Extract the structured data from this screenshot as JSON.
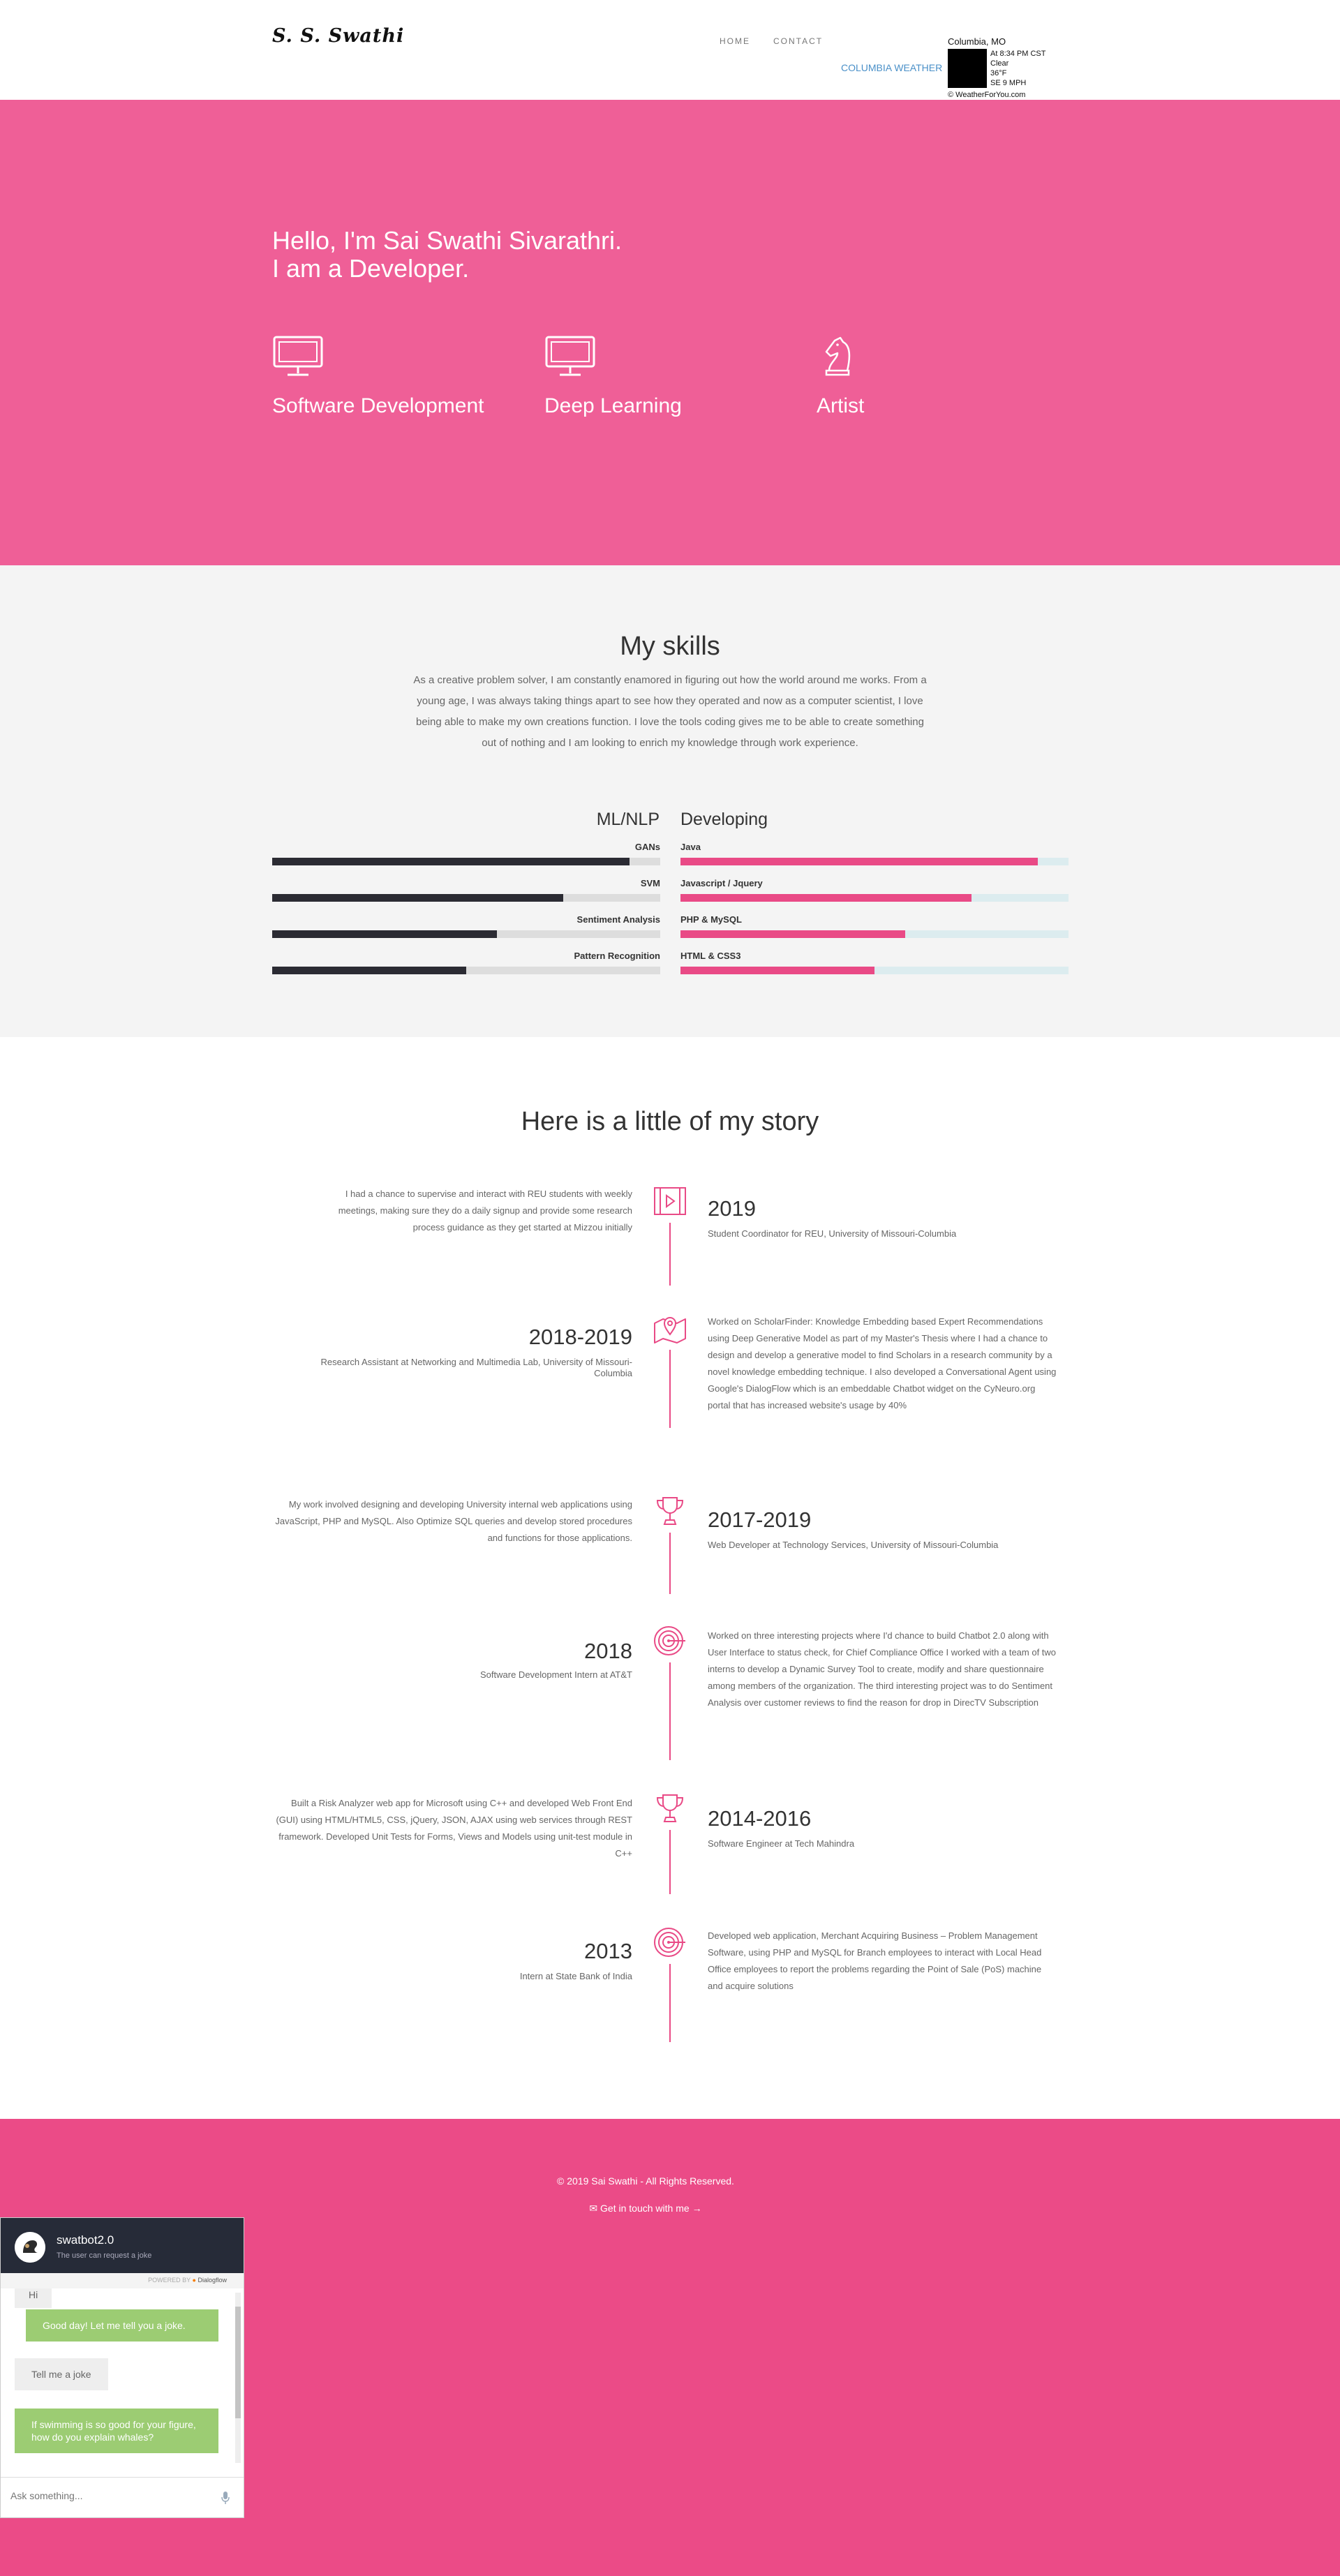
{
  "nav": {
    "logo": "S. S. Swathi",
    "home": "HOME",
    "contact": "CONTACT"
  },
  "weather": {
    "link": "COLUMBIA WEATHER",
    "city": "Columbia, MO",
    "time": "At 8:34 PM CST",
    "condition": "Clear",
    "temp": "36°F",
    "wind": "SE 9 MPH",
    "source": "© WeatherForYou.com"
  },
  "hero": {
    "line1": "Hello, I'm Sai Swathi Sivarathri.",
    "line2": "I am a Developer.",
    "services": [
      {
        "label": "Software Development",
        "icon": "monitor-icon"
      },
      {
        "label": "Deep Learning",
        "icon": "monitor-icon"
      },
      {
        "label": "Artist",
        "icon": "chess-knight-icon"
      }
    ]
  },
  "skills": {
    "title": "My skills",
    "description": "As a creative problem solver, I am constantly enamored in figuring out how the world around me works. From a young age, I was always taking things apart to see how they operated and now as a computer scientist, I love being able to make my own creations function. I love the tools coding gives me to be able to create something out of nothing and I am looking to enrich my knowledge through work experience.",
    "ml_title": "ML/NLP",
    "dev_title": "Developing",
    "ml": [
      {
        "name": "GANs",
        "level": 92
      },
      {
        "name": "SVM",
        "level": 75
      },
      {
        "name": "Sentiment Analysis",
        "level": 58
      },
      {
        "name": "Pattern Recognition",
        "level": 50
      }
    ],
    "dev": [
      {
        "name": "Java",
        "level": 92
      },
      {
        "name": "Javascript / Jquery",
        "level": 75
      },
      {
        "name": "PHP & MySQL",
        "level": 58
      },
      {
        "name": "HTML & CSS3",
        "level": 50
      }
    ]
  },
  "story": {
    "title": "Here is a little of my story",
    "items": [
      {
        "year": "2019",
        "role": "Student Coordinator for REU, University of Missouri-Columbia",
        "description": "I had a chance to supervise and interact with REU students with weekly meetings, making sure they do a daily signup and provide some research process guidance as they get started at Mizzou initially",
        "icon": "video-icon"
      },
      {
        "year": "2018-2019",
        "role": "Research Assistant at Networking and Multimedia Lab, University of Missouri-Columbia",
        "description": "Worked on ScholarFinder: Knowledge Embedding based Expert Recommendations using Deep Generative Model as part of my Master's Thesis where I had a chance to design and develop a generative model to find Scholars in a research community by a novel knowledge embedding technique. I also developed a Conversational Agent using Google's DialogFlow which is an embeddable Chatbot widget on the CyNeuro.org portal that has increased website's usage by 40%",
        "icon": "map-pin-icon"
      },
      {
        "year": "2017-2019",
        "role": "Web Developer at Technology Services, University of Missouri-Columbia",
        "description": "My work involved designing and developing University internal web applications using JavaScript, PHP and MySQL. Also Optimize SQL queries and develop stored procedures and functions for those applications.",
        "icon": "trophy-icon"
      },
      {
        "year": "2018",
        "role": "Software Development Intern at AT&T",
        "description": "Worked on three interesting projects where I'd chance to build Chatbot 2.0 along with User Interface to status check, for Chief Compliance Office I worked with a team of two interns to develop a Dynamic Survey Tool to create, modify and share questionnaire among members of the organization. The third interesting project was to do Sentiment Analysis over customer reviews to find the reason for drop in DirecTV Subscription",
        "icon": "target-icon"
      },
      {
        "year": "2014-2016",
        "role": "Software Engineer at Tech Mahindra",
        "description": "Built a Risk Analyzer web app for Microsoft using C++ and developed Web Front End (GUI) using HTML/HTML5, CSS, jQuery, JSON, AJAX using web services through REST framework. Developed Unit Tests for Forms, Views and Models using unit-test module in C++",
        "icon": "trophy-icon"
      },
      {
        "year": "2013",
        "role": "Intern at State Bank of India",
        "description": "Developed web application, Merchant Acquiring Business – Problem Management Software, using PHP and MySQL for Branch employees to interact with Local Head Office employees to report the problems regarding the Point of Sale (PoS) machine and acquire solutions",
        "icon": "target-icon"
      }
    ]
  },
  "footer": {
    "copyright": "© 2019 Sai Swathi - All Rights Reserved.",
    "contact": "Get in touch with me"
  },
  "chat": {
    "name": "swatbot2.0",
    "subtitle": "The user can request a joke",
    "powered": "POWERED BY",
    "powered_brand": "Dialogflow",
    "messages": [
      {
        "from": "user",
        "text": "Hi"
      },
      {
        "from": "bot",
        "text": "Good day! Let me tell you a joke."
      },
      {
        "from": "user",
        "text": "Tell me a joke"
      },
      {
        "from": "bot",
        "text": "If swimming is so good for your figure, how do you explain whales?"
      }
    ],
    "placeholder": "Ask something..."
  }
}
